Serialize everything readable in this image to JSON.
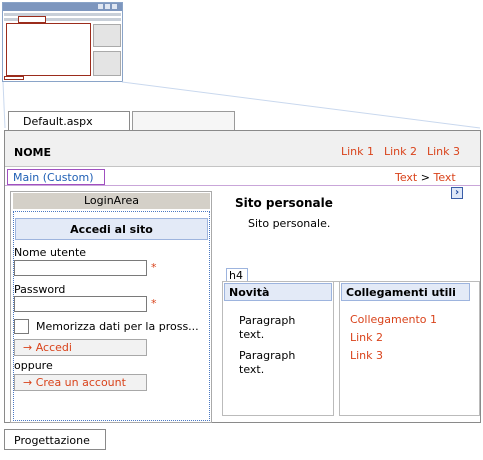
{
  "thumbnail": {},
  "document_tab": "Default.aspx",
  "header": {
    "site_name": "NOME",
    "links": [
      "Link 1",
      "Link 2",
      "Link 3"
    ]
  },
  "content_area_label": "Main (Custom)",
  "breadcrumb": {
    "item1": "Text",
    "separator": ">",
    "item2": "Text"
  },
  "login": {
    "area_title": "LoginArea",
    "heading": "Accedi al sito",
    "username_label": "Nome utente",
    "username_value": "",
    "password_label": "Password",
    "password_value": "",
    "required_mark": "*",
    "remember_label": "Memorizza dati per la pross...",
    "login_button": "→ Accedi",
    "or_text": "oppure",
    "create_account_button": "→ Crea un account"
  },
  "site": {
    "title": "Sito personale",
    "text": "Sito personale.",
    "icon_glyph": "›"
  },
  "heading_tag": "h4",
  "news": {
    "title": "Novità",
    "paragraphs": [
      {
        "line1": "Paragraph",
        "line2": "text."
      },
      {
        "line1": "Paragraph",
        "line2": "text."
      }
    ]
  },
  "useful_links": {
    "title": "Collegamenti utili",
    "links": [
      "Collegamento 1",
      "Link 2",
      "Link 3"
    ]
  },
  "view_tab": "Progettazione",
  "colors": {
    "link": "#d9431b",
    "accent_blue": "#1f5fb5",
    "panel_head": "#e3eaf7"
  }
}
